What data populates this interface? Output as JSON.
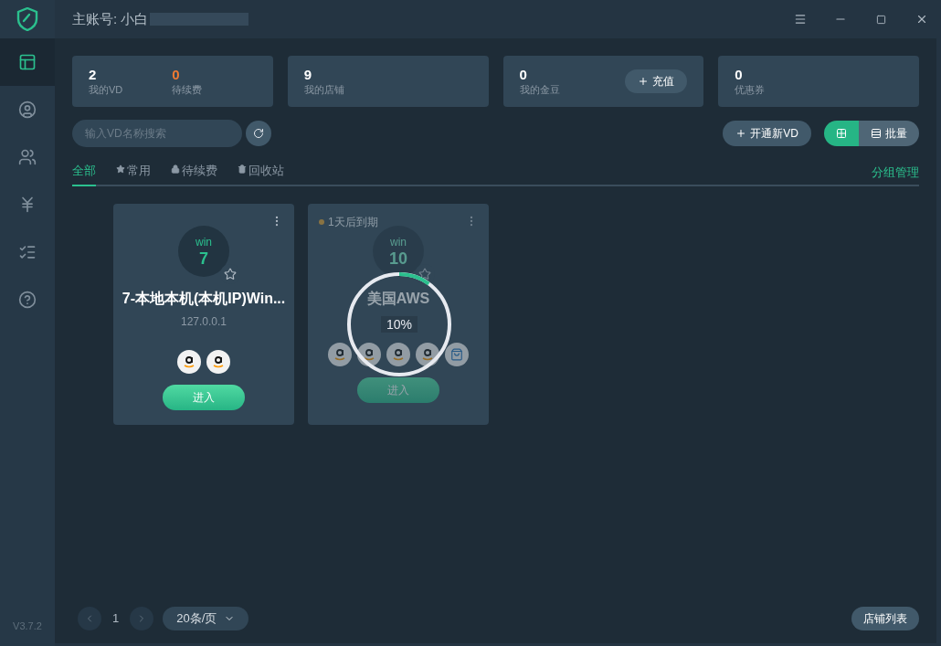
{
  "window": {
    "account_label": "主账号: 小白"
  },
  "sidebar": {
    "items": [
      {
        "kind": "layout",
        "selected": true
      },
      {
        "kind": "user",
        "selected": false
      },
      {
        "kind": "users",
        "selected": false
      },
      {
        "kind": "yen",
        "selected": false
      },
      {
        "kind": "list",
        "selected": false
      },
      {
        "kind": "help",
        "selected": false
      }
    ],
    "version": "V3.7.2"
  },
  "stats": [
    {
      "kind": "double",
      "items": [
        {
          "value": "2",
          "label": "我的VD",
          "highlight": false
        },
        {
          "value": "0",
          "label": "待续费",
          "highlight": true
        }
      ]
    },
    {
      "kind": "single",
      "items": [
        {
          "value": "9",
          "label": "我的店铺",
          "highlight": false
        }
      ]
    },
    {
      "kind": "recharge",
      "items": [
        {
          "value": "0",
          "label": "我的金豆",
          "highlight": false
        }
      ],
      "button": "充值"
    },
    {
      "kind": "single",
      "items": [
        {
          "value": "0",
          "label": "优惠券",
          "highlight": false
        }
      ]
    }
  ],
  "search": {
    "placeholder": "输入VD名称搜索"
  },
  "toolbar": {
    "new_button": "开通新VD",
    "view_toggle": [
      {
        "kind": "grid",
        "selected": true
      },
      {
        "kind": "list",
        "label": "批量",
        "selected": false
      }
    ]
  },
  "tabs": [
    {
      "label": "全部",
      "kind": "plain",
      "selected": true
    },
    {
      "label": "常用",
      "kind": "star",
      "selected": false
    },
    {
      "label": "待续费",
      "kind": "lock",
      "selected": false
    },
    {
      "label": "回收站",
      "kind": "trash",
      "selected": false
    }
  ],
  "group_manage": "分组管理",
  "cards": [
    {
      "os_label": "win",
      "os_version": "7",
      "name": "7-本地本机(本机IP)Win...",
      "ip": "127.0.0.1",
      "stores": [
        {
          "kind": "amazon"
        },
        {
          "kind": "amazon"
        }
      ],
      "button": "进入",
      "loading": false
    },
    {
      "os_label": "win",
      "os_version": "10",
      "name": "美国AWS",
      "expiry": "1天后到期",
      "stores": [
        {
          "kind": "amazon"
        },
        {
          "kind": "amazon"
        },
        {
          "kind": "amazon"
        },
        {
          "kind": "amazon"
        },
        {
          "kind": "shop"
        }
      ],
      "button": "进入",
      "loading": true,
      "level": 0.1,
      "progress": "10%"
    }
  ],
  "pagination": {
    "page": "1",
    "page_size": "20条/页"
  },
  "store_list_button": "店铺列表"
}
